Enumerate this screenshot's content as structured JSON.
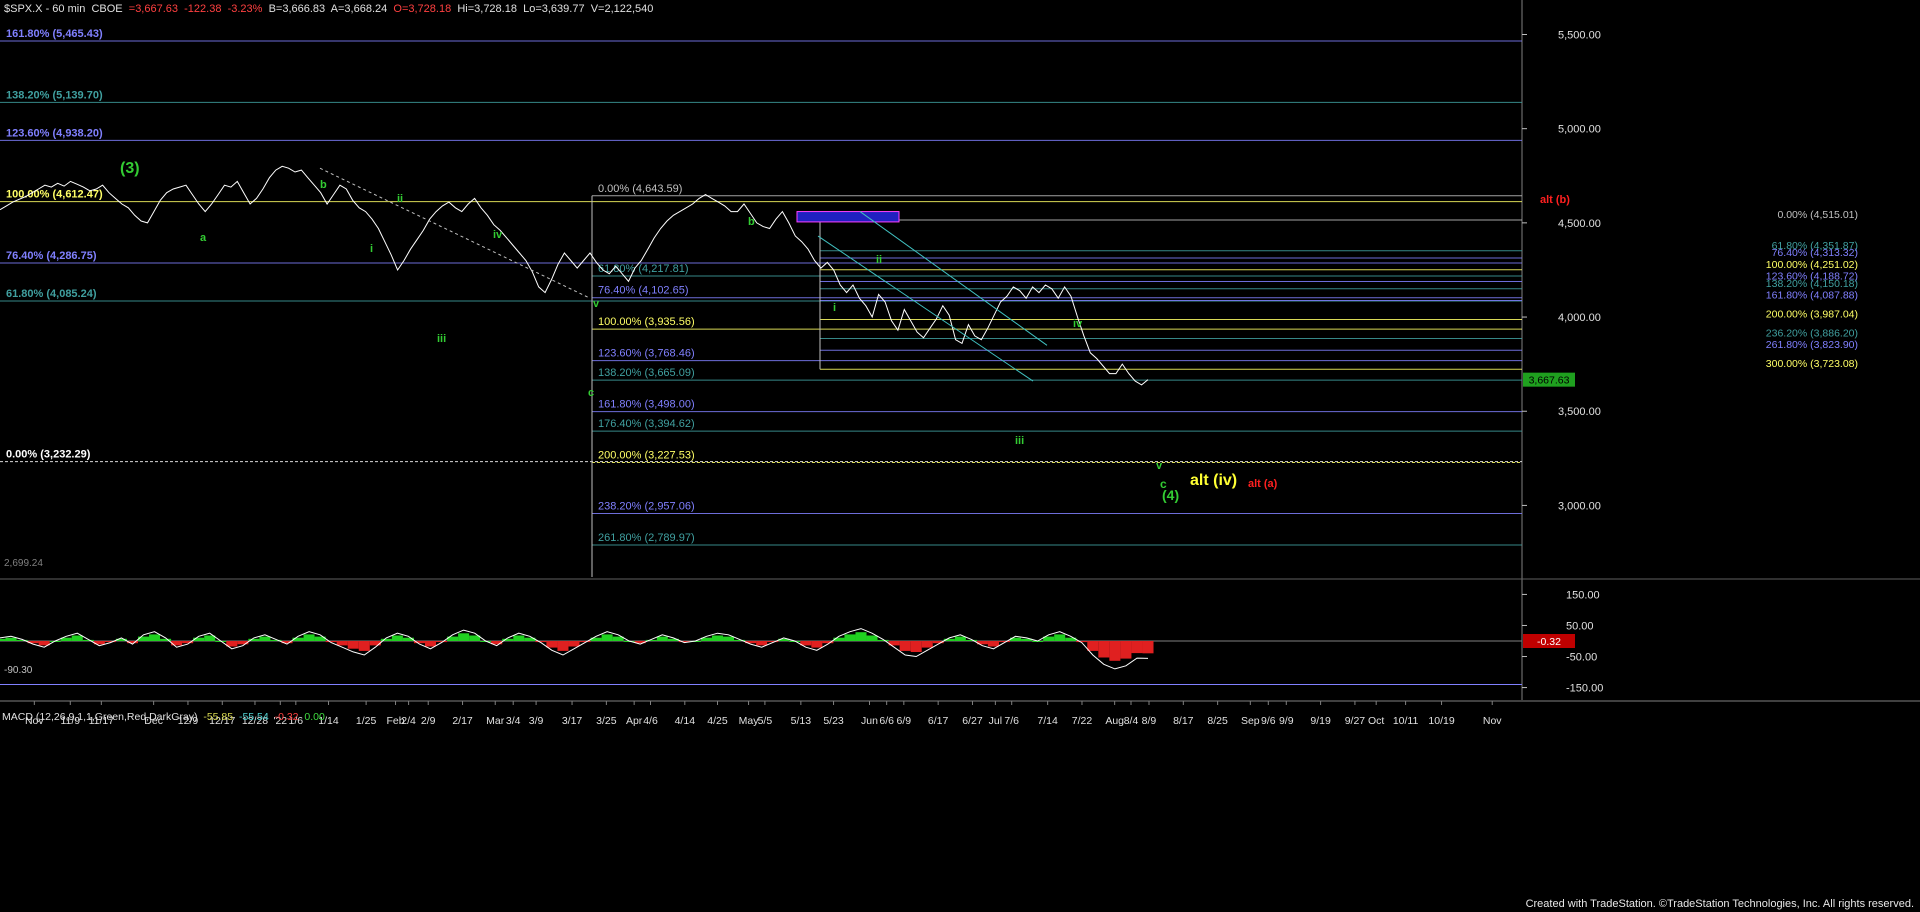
{
  "header": {
    "symbol": "$SPX.X - 60 min",
    "exchange": "CBOE",
    "last": "=3,667.63",
    "change": "-122.38",
    "change_pct": "-3.23%",
    "bid": "B=3,666.83",
    "ask": "A=3,668.24",
    "open": "O=3,728.18",
    "high": "Hi=3,728.18",
    "low": "Lo=3,639.77",
    "volume": "V=2,122,540"
  },
  "macd_header": {
    "label": "MACD (12,26,9,1,1,Green,Red,DarkGray)",
    "macd": "-55.85",
    "avg": "-55.54",
    "diff": "-0.32",
    "zero": "0.00"
  },
  "credit": "Created with TradeStation. ©TradeStation Technologies, Inc. All rights reserved.",
  "colors": {
    "background": "#000000",
    "price": "#ffffff",
    "wave_label": "#33cc33",
    "alt_label": "#ff2020",
    "alt_iv": "#ffff33",
    "fib_blue": "#8080ff",
    "fib_teal": "#40a0a0",
    "fib_yellow": "#ffff66",
    "fib_gray": "#c0c0c0",
    "macd_pos": "#20d020",
    "macd_neg": "#e02020",
    "box": "#2020c0"
  },
  "chart_data": {
    "type": "line",
    "title": "",
    "price_axis": {
      "min": 2620,
      "max": 5630,
      "ticks": [
        5500,
        5000,
        4500,
        4000,
        3500,
        3000
      ],
      "tick_labels": [
        "5,500.00",
        "5,000.00",
        "4,500.00",
        "4,000.00",
        "3,500.00",
        "3,000.00"
      ],
      "last_price": 3667.63,
      "last_price_label": "3,667.63"
    },
    "macd_axis": {
      "min": -190,
      "max": 190,
      "ticks": [
        150,
        50,
        -50,
        -150
      ],
      "tick_labels": [
        "150.00",
        "50.00",
        "-50.00",
        "-150.00"
      ],
      "current_label": "-0.32"
    },
    "x_axis": {
      "labels": [
        "Nov",
        "11/9",
        "11/17",
        "Dec",
        "12/9",
        "12/17",
        "12/28",
        "'22",
        "1/6",
        "1/14",
        "1/25",
        "Feb",
        "2/4",
        "2/9",
        "2/17",
        "Mar",
        "3/4",
        "3/9",
        "3/17",
        "3/25",
        "Apr",
        "4/6",
        "4/14",
        "4/25",
        "May",
        "5/5",
        "5/13",
        "5/23",
        "Jun",
        "6/6",
        "6/9",
        "6/17",
        "6/27",
        "Jul",
        "7/6",
        "7/14",
        "7/22",
        "Aug",
        "8/4",
        "8/9",
        "8/17",
        "8/25",
        "Sep",
        "9/6",
        "9/9",
        "9/19",
        "9/27",
        "Oct",
        "10/11",
        "10/19",
        "Nov"
      ]
    },
    "series": [
      {
        "values": [
          4570,
          4590,
          4610,
          4625,
          4640,
          4660,
          4680,
          4700,
          4690,
          4710,
          4695,
          4720,
          4705,
          4690,
          4670,
          4680,
          4700,
          4660,
          4630,
          4600,
          4580,
          4540,
          4510,
          4500,
          4560,
          4620,
          4660,
          4680,
          4690,
          4700,
          4650,
          4600,
          4560,
          4600,
          4650,
          4700,
          4690,
          4720,
          4660,
          4600,
          4630,
          4680,
          4740,
          4780,
          4800,
          4790,
          4770,
          4780,
          4740,
          4700,
          4660,
          4600,
          4650,
          4700,
          4680,
          4620,
          4580,
          4560,
          4520,
          4470,
          4400,
          4330,
          4250,
          4300,
          4360,
          4410,
          4460,
          4520,
          4560,
          4590,
          4610,
          4580,
          4560,
          4600,
          4630,
          4580,
          4540,
          4490,
          4460,
          4420,
          4380,
          4340,
          4300,
          4240,
          4160,
          4130,
          4200,
          4280,
          4340,
          4300,
          4260,
          4300,
          4340,
          4290,
          4250,
          4230,
          4270,
          4230,
          4190,
          4260,
          4300,
          4360,
          4420,
          4470,
          4510,
          4540,
          4560,
          4580,
          4600,
          4630,
          4650,
          4630,
          4610,
          4590,
          4560,
          4560,
          4600,
          4550,
          4500,
          4480,
          4470,
          4520,
          4560,
          4500,
          4430,
          4400,
          4360,
          4300,
          4260,
          4290,
          4250,
          4170,
          4130,
          4170,
          4100,
          4060,
          4000,
          4120,
          4080,
          3980,
          3930,
          4040,
          3980,
          3920,
          3890,
          3940,
          3990,
          4060,
          4010,
          3880,
          3860,
          3960,
          3900,
          3880,
          3940,
          4010,
          4080,
          4110,
          4160,
          4140,
          4100,
          4160,
          4130,
          4170,
          4150,
          4100,
          4160,
          4110,
          4000,
          3900,
          3810,
          3780,
          3740,
          3700,
          3700,
          3750,
          3700,
          3660,
          3640,
          3668
        ]
      },
      {
        "name": "MACD",
        "values": [
          10,
          15,
          5,
          -10,
          -20,
          0,
          15,
          25,
          5,
          -15,
          -5,
          10,
          -10,
          20,
          30,
          10,
          -20,
          -10,
          15,
          25,
          0,
          -25,
          -15,
          10,
          20,
          5,
          -10,
          15,
          30,
          20,
          -5,
          -20,
          -35,
          -45,
          -20,
          10,
          25,
          15,
          -10,
          -25,
          -5,
          20,
          35,
          25,
          0,
          -15,
          10,
          25,
          15,
          -5,
          -30,
          -45,
          -25,
          -5,
          15,
          30,
          20,
          0,
          -10,
          5,
          20,
          10,
          -5,
          0,
          15,
          25,
          20,
          5,
          -10,
          -20,
          -5,
          10,
          0,
          -20,
          -30,
          -10,
          15,
          30,
          40,
          25,
          5,
          -20,
          -45,
          -50,
          -30,
          -10,
          10,
          20,
          5,
          -15,
          -25,
          -5,
          15,
          10,
          0,
          20,
          30,
          15,
          -5,
          -45,
          -75,
          -90,
          -80,
          -55,
          -56
        ]
      }
    ],
    "fib_levels": [
      {
        "label": "161.80% (5,465.43)",
        "value": 5465.43,
        "color": "#8080ff",
        "span": "full"
      },
      {
        "label": "138.20% (5,139.70)",
        "value": 5139.7,
        "color": "#40a0a0",
        "span": "full"
      },
      {
        "label": "123.60% (4,938.20)",
        "value": 4938.2,
        "color": "#8080ff",
        "span": "full"
      },
      {
        "label": "100.00% (4,612.47)",
        "value": 4612.47,
        "color": "#ffff66",
        "span": "full"
      },
      {
        "label": "76.40% (4,286.75)",
        "value": 4286.75,
        "color": "#8080ff",
        "span": "full"
      },
      {
        "label": "61.80% (4,085.24)",
        "value": 4085.24,
        "color": "#40a0a0",
        "span": "full"
      },
      {
        "label": "0.00% (3,232.29)",
        "value": 3232.29,
        "color": "#ffffff",
        "span": "full",
        "dashed": true
      },
      {
        "label": "0.00% (4,643.59)",
        "value": 4643.59,
        "color": "#c0c0c0",
        "span": "mid"
      },
      {
        "label": "61.80% (4,217.81)",
        "value": 4217.81,
        "color": "#40a0a0",
        "span": "mid"
      },
      {
        "label": "76.40% (4,102.65)",
        "value": 4102.65,
        "color": "#8080ff",
        "span": "mid"
      },
      {
        "label": "100.00% (3,935.56)",
        "value": 3935.56,
        "color": "#ffff66",
        "span": "mid"
      },
      {
        "label": "123.60% (3,768.46)",
        "value": 3768.46,
        "color": "#8080ff",
        "span": "mid"
      },
      {
        "label": "138.20% (3,665.09)",
        "value": 3665.09,
        "color": "#40a0a0",
        "span": "mid"
      },
      {
        "label": "161.80% (3,498.00)",
        "value": 3498.0,
        "color": "#8080ff",
        "span": "mid"
      },
      {
        "label": "176.40% (3,394.62)",
        "value": 3394.62,
        "color": "#40a0a0",
        "span": "mid"
      },
      {
        "label": "200.00% (3,227.53)",
        "value": 3227.53,
        "color": "#ffff66",
        "span": "mid",
        "dashed": true
      },
      {
        "label": "238.20% (2,957.06)",
        "value": 2957.06,
        "color": "#8080ff",
        "span": "mid"
      },
      {
        "label": "261.80% (2,789.97)",
        "value": 2789.97,
        "color": "#40a0a0",
        "span": "mid"
      },
      {
        "label": "0.00% (4,515.01)",
        "value": 4515.01,
        "color": "#c0c0c0",
        "span": "right"
      },
      {
        "label": "61.80% (4,351.87)",
        "value": 4351.87,
        "color": "#40a0a0",
        "span": "right"
      },
      {
        "label": "76.40% (4,313.32)",
        "value": 4313.32,
        "color": "#8080ff",
        "span": "right"
      },
      {
        "label": "100.00% (4,251.02)",
        "value": 4251.02,
        "color": "#ffff66",
        "span": "right"
      },
      {
        "label": "123.60% (4,188.72)",
        "value": 4188.72,
        "color": "#8080ff",
        "span": "right"
      },
      {
        "label": "138.20% (4,150.18)",
        "value": 4150.18,
        "color": "#40a0a0",
        "span": "right"
      },
      {
        "label": "161.80% (4,087.88)",
        "value": 4087.88,
        "color": "#8080ff",
        "span": "right"
      },
      {
        "label": "200.00% (3,987.04)",
        "value": 3987.04,
        "color": "#ffff66",
        "span": "right"
      },
      {
        "label": "236.20% (3,886.20)",
        "value": 3886.2,
        "color": "#40a0a0",
        "span": "right"
      },
      {
        "label": "261.80% (3,823.90)",
        "value": 3823.9,
        "color": "#8080ff",
        "span": "right"
      },
      {
        "label": "300.00% (3,723.08)",
        "value": 3723.08,
        "color": "#ffff66",
        "span": "right"
      }
    ],
    "low_marker": {
      "label": "2,699.24",
      "value": 2699.24
    },
    "macd_marker": {
      "label": "-90.30",
      "value": -90.3
    },
    "wave_labels": [
      {
        "text": "(3)",
        "color": "#33cc33"
      },
      {
        "text": "a",
        "color": "#33cc33"
      },
      {
        "text": "b",
        "color": "#33cc33"
      },
      {
        "text": "i",
        "color": "#33cc33"
      },
      {
        "text": "ii",
        "color": "#33cc33"
      },
      {
        "text": "iii",
        "color": "#33cc33"
      },
      {
        "text": "iv",
        "color": "#33cc33"
      },
      {
        "text": "v",
        "color": "#33cc33"
      },
      {
        "text": "c",
        "color": "#33cc33"
      },
      {
        "text": "b",
        "color": "#33cc33"
      },
      {
        "text": "i",
        "color": "#33cc33"
      },
      {
        "text": "ii",
        "color": "#33cc33"
      },
      {
        "text": "iii",
        "color": "#33cc33"
      },
      {
        "text": "iv",
        "color": "#33cc33"
      },
      {
        "text": "v",
        "color": "#33cc33"
      },
      {
        "text": "c",
        "color": "#33cc33"
      },
      {
        "text": "(4)",
        "color": "#33cc33"
      },
      {
        "text": "alt (iv)",
        "color": "#ffff33"
      },
      {
        "text": "alt (a)",
        "color": "#ff2020"
      },
      {
        "text": "alt (b)",
        "color": "#ff2020"
      }
    ]
  }
}
